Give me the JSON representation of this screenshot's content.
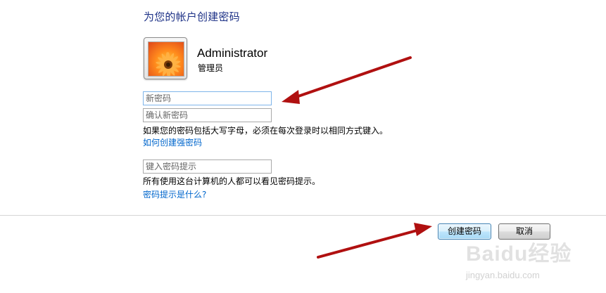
{
  "header": {
    "title": "为您的帐户创建密码"
  },
  "user": {
    "name": "Administrator",
    "role": "管理员",
    "avatar_icon": "flower-icon"
  },
  "form": {
    "new_password_placeholder": "新密码",
    "confirm_password_placeholder": "确认新密码",
    "case_note": "如果您的密码包括大写字母，必须在每次登录时以相同方式键入。",
    "strong_password_link": "如何创建强密码",
    "hint_placeholder": "键入密码提示",
    "hint_visible_note": "所有使用这台计算机的人都可以看见密码提示。",
    "hint_help_link": "密码提示是什么?"
  },
  "buttons": {
    "create_label": "创建密码",
    "cancel_label": "取消"
  },
  "annotations": {
    "arrow_color": "#b01010"
  },
  "watermark": {
    "brand": "Baidu经验",
    "url": "jingyan.baidu.com"
  }
}
